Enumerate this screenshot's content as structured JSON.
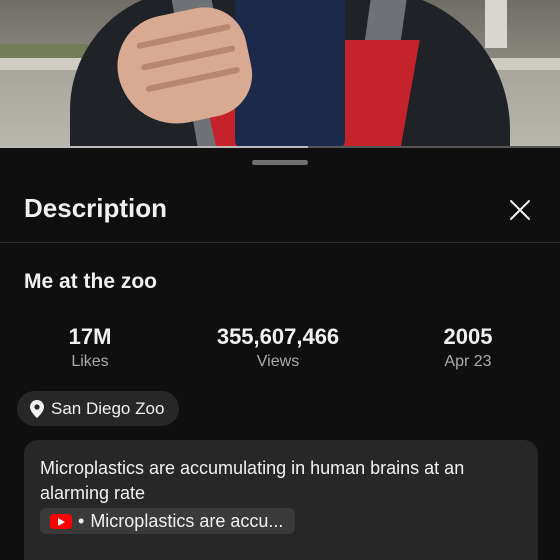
{
  "player": {
    "progress_fraction": 0.55
  },
  "panel": {
    "title": "Description",
    "close_icon": "close-icon"
  },
  "video": {
    "title": "Me at the zoo",
    "stats": [
      {
        "value": "17M",
        "label": "Likes"
      },
      {
        "value": "355,607,466",
        "label": "Views"
      },
      {
        "value": "2005",
        "label": "Apr 23"
      }
    ],
    "location": "San Diego Zoo",
    "description": "Microplastics are accumulating in human brains at an alarming rate",
    "mention": {
      "icon": "youtube-icon",
      "label": "Microplastics are accu..."
    }
  },
  "colors": {
    "background": "#0f0f0f",
    "surface": "#272727",
    "accent": "#ff0000",
    "muted_text": "#aaaaaa"
  }
}
